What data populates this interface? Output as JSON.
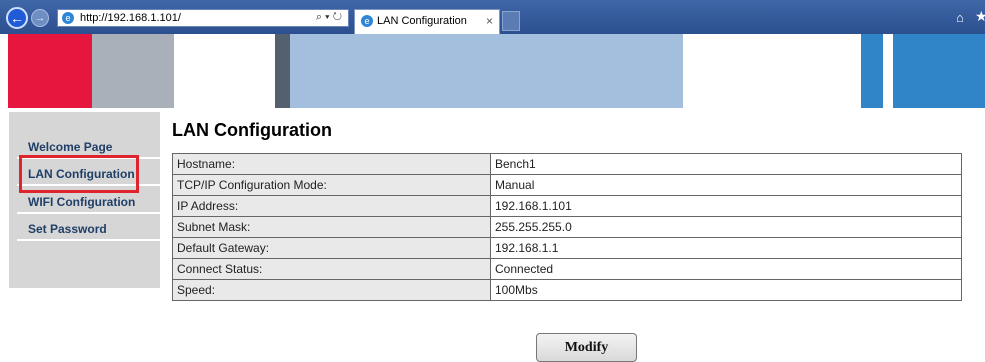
{
  "browser": {
    "url": "http://192.168.1.101/",
    "address_controls": "⌕ ▾ ↻",
    "tab_title": "LAN Configuration",
    "tab_close": "×",
    "ie_glyph": "e",
    "back_glyph": "←",
    "forward_glyph": "→",
    "home_glyph": "⌂",
    "favorites_glyph": "★"
  },
  "colors": {
    "banner_red": "#e6163f",
    "banner_gray": "#a9b0ba",
    "banner_light_blue": "#a3bfdd",
    "banner_blue": "#2f85c8",
    "sidebar_bg": "#d6d6d6",
    "sidebar_text": "#1f3f66",
    "highlight": "#e0242e"
  },
  "sidebar": {
    "items": [
      {
        "label": "Welcome Page"
      },
      {
        "label": "LAN Configuration"
      },
      {
        "label": "WIFI Configuration"
      },
      {
        "label": "Set Password"
      }
    ]
  },
  "main": {
    "title": "LAN Configuration",
    "rows": [
      {
        "label": "Hostname:",
        "value": "Bench1"
      },
      {
        "label": "TCP/IP Configuration Mode:",
        "value": "Manual"
      },
      {
        "label": "IP Address:",
        "value": "192.168.1.101"
      },
      {
        "label": "Subnet Mask:",
        "value": "255.255.255.0"
      },
      {
        "label": "Default Gateway:",
        "value": "192.168.1.1"
      },
      {
        "label": "Connect Status:",
        "value": "Connected"
      },
      {
        "label": "Speed:",
        "value": "100Mbs"
      }
    ],
    "modify_label": "Modify"
  }
}
